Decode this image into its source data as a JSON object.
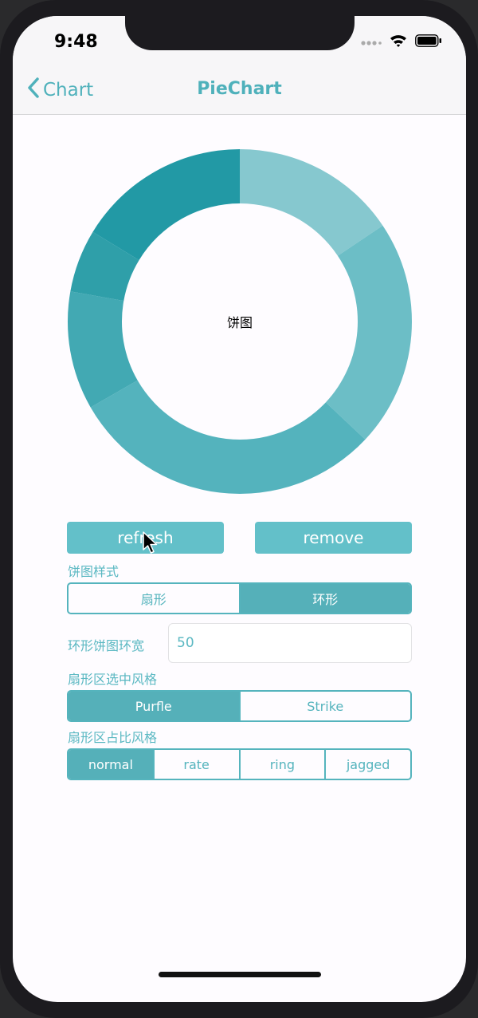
{
  "status_bar": {
    "time": "9:48"
  },
  "nav": {
    "back_label": "Chart",
    "title": "PieChart"
  },
  "pie": {
    "center_text": "饼图"
  },
  "actions": {
    "refresh_label": "refresh",
    "remove_label": "remove"
  },
  "pie_style": {
    "label": "饼图样式",
    "options": [
      "扇形",
      "环形"
    ],
    "selected": "环形"
  },
  "ring_width": {
    "label": "环形饼图环宽",
    "value": "50"
  },
  "select_style": {
    "label": "扇形区选中风格",
    "options": [
      "Purfle",
      "Strike"
    ],
    "selected": "Purfle"
  },
  "ratio_style": {
    "label": "扇形区占比风格",
    "options": [
      "normal",
      "rate",
      "ring",
      "jagged"
    ],
    "selected": "normal"
  },
  "colors": {
    "accent": "#55b4bd"
  },
  "icons": [
    "chevron-left-icon",
    "signal-icon",
    "wifi-icon",
    "battery-icon",
    "cursor-icon"
  ],
  "chart_data": {
    "type": "pie",
    "values": [
      15.6,
      21.4,
      29.7,
      11.1,
      5.9,
      16.3
    ],
    "colors": [
      "#86c8cf",
      "#6cbec6",
      "#54b3bd",
      "#42a9b3",
      "#2f9fa9",
      "#2299a5"
    ]
  }
}
